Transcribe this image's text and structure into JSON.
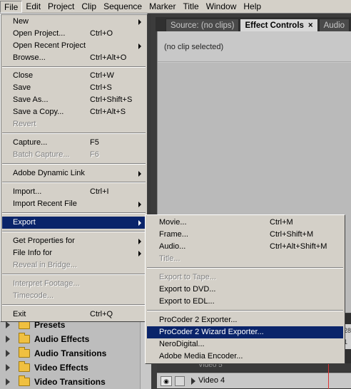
{
  "menubar": {
    "items": [
      "File",
      "Edit",
      "Project",
      "Clip",
      "Sequence",
      "Marker",
      "Title",
      "Window",
      "Help"
    ]
  },
  "tabs": {
    "source": "Source: (no clips)",
    "effect_controls": "Effect Controls",
    "audio_partial": "Audio",
    "close_glyph": "×"
  },
  "effect_controls": {
    "status": "(no clip selected)"
  },
  "file_menu": {
    "items": [
      {
        "label": "New",
        "shortcut": "",
        "submenu": true,
        "disabled": false
      },
      {
        "label": "Open Project...",
        "shortcut": "Ctrl+O",
        "submenu": false,
        "disabled": false
      },
      {
        "label": "Open Recent Project",
        "shortcut": "",
        "submenu": true,
        "disabled": false
      },
      {
        "label": "Browse...",
        "shortcut": "Ctrl+Alt+O",
        "submenu": false,
        "disabled": false
      },
      {
        "label": "Close",
        "shortcut": "Ctrl+W",
        "submenu": false,
        "disabled": false
      },
      {
        "label": "Save",
        "shortcut": "Ctrl+S",
        "submenu": false,
        "disabled": false
      },
      {
        "label": "Save As...",
        "shortcut": "Ctrl+Shift+S",
        "submenu": false,
        "disabled": false
      },
      {
        "label": "Save a Copy...",
        "shortcut": "Ctrl+Alt+S",
        "submenu": false,
        "disabled": false
      },
      {
        "label": "Revert",
        "shortcut": "",
        "submenu": false,
        "disabled": true
      },
      {
        "label": "Capture...",
        "shortcut": "F5",
        "submenu": false,
        "disabled": false
      },
      {
        "label": "Batch Capture...",
        "shortcut": "F6",
        "submenu": false,
        "disabled": true
      },
      {
        "label": "Adobe Dynamic Link",
        "shortcut": "",
        "submenu": true,
        "disabled": false
      },
      {
        "label": "Import...",
        "shortcut": "Ctrl+I",
        "submenu": false,
        "disabled": false
      },
      {
        "label": "Import Recent File",
        "shortcut": "",
        "submenu": true,
        "disabled": false
      },
      {
        "label": "Export",
        "shortcut": "",
        "submenu": true,
        "disabled": false
      },
      {
        "label": "Get Properties for",
        "shortcut": "",
        "submenu": true,
        "disabled": false
      },
      {
        "label": "File Info for",
        "shortcut": "",
        "submenu": true,
        "disabled": false
      },
      {
        "label": "Reveal in Bridge...",
        "shortcut": "",
        "submenu": false,
        "disabled": true
      },
      {
        "label": "Interpret Footage...",
        "shortcut": "",
        "submenu": false,
        "disabled": true
      },
      {
        "label": "Timecode...",
        "shortcut": "",
        "submenu": false,
        "disabled": true
      },
      {
        "label": "Exit",
        "shortcut": "Ctrl+Q",
        "submenu": false,
        "disabled": false
      }
    ]
  },
  "export_menu": {
    "items": [
      {
        "label": "Movie...",
        "shortcut": "Ctrl+M",
        "disabled": false
      },
      {
        "label": "Frame...",
        "shortcut": "Ctrl+Shift+M",
        "disabled": false
      },
      {
        "label": "Audio...",
        "shortcut": "Ctrl+Alt+Shift+M",
        "disabled": false
      },
      {
        "label": "Title...",
        "shortcut": "",
        "disabled": true
      },
      {
        "label": "Export to Tape...",
        "shortcut": "",
        "disabled": true
      },
      {
        "label": "Export to DVD...",
        "shortcut": "",
        "disabled": false
      },
      {
        "label": "Export to EDL...",
        "shortcut": "",
        "disabled": false
      },
      {
        "label": "ProCoder 2 Exporter...",
        "shortcut": "",
        "disabled": false
      },
      {
        "label": "ProCoder 2 Wizard Exporter...",
        "shortcut": "",
        "disabled": false
      },
      {
        "label": "NeroDigital...",
        "shortcut": "",
        "disabled": false
      },
      {
        "label": "Adobe Media Encoder...",
        "shortcut": "",
        "disabled": false
      }
    ]
  },
  "effects_panel": {
    "items": [
      "Presets",
      "Audio Effects",
      "Audio Transitions",
      "Video Effects",
      "Video Transitions"
    ]
  },
  "timeline": {
    "track_name": "Video 4",
    "track_partial": "Video 5",
    "ruler_top": "28",
    "ruler_bottom": "1"
  },
  "colors": {
    "menu_bg": "#d4d0c8",
    "highlight": "#0a246a",
    "disabled_text": "#808080",
    "folder": "#f0c040"
  }
}
